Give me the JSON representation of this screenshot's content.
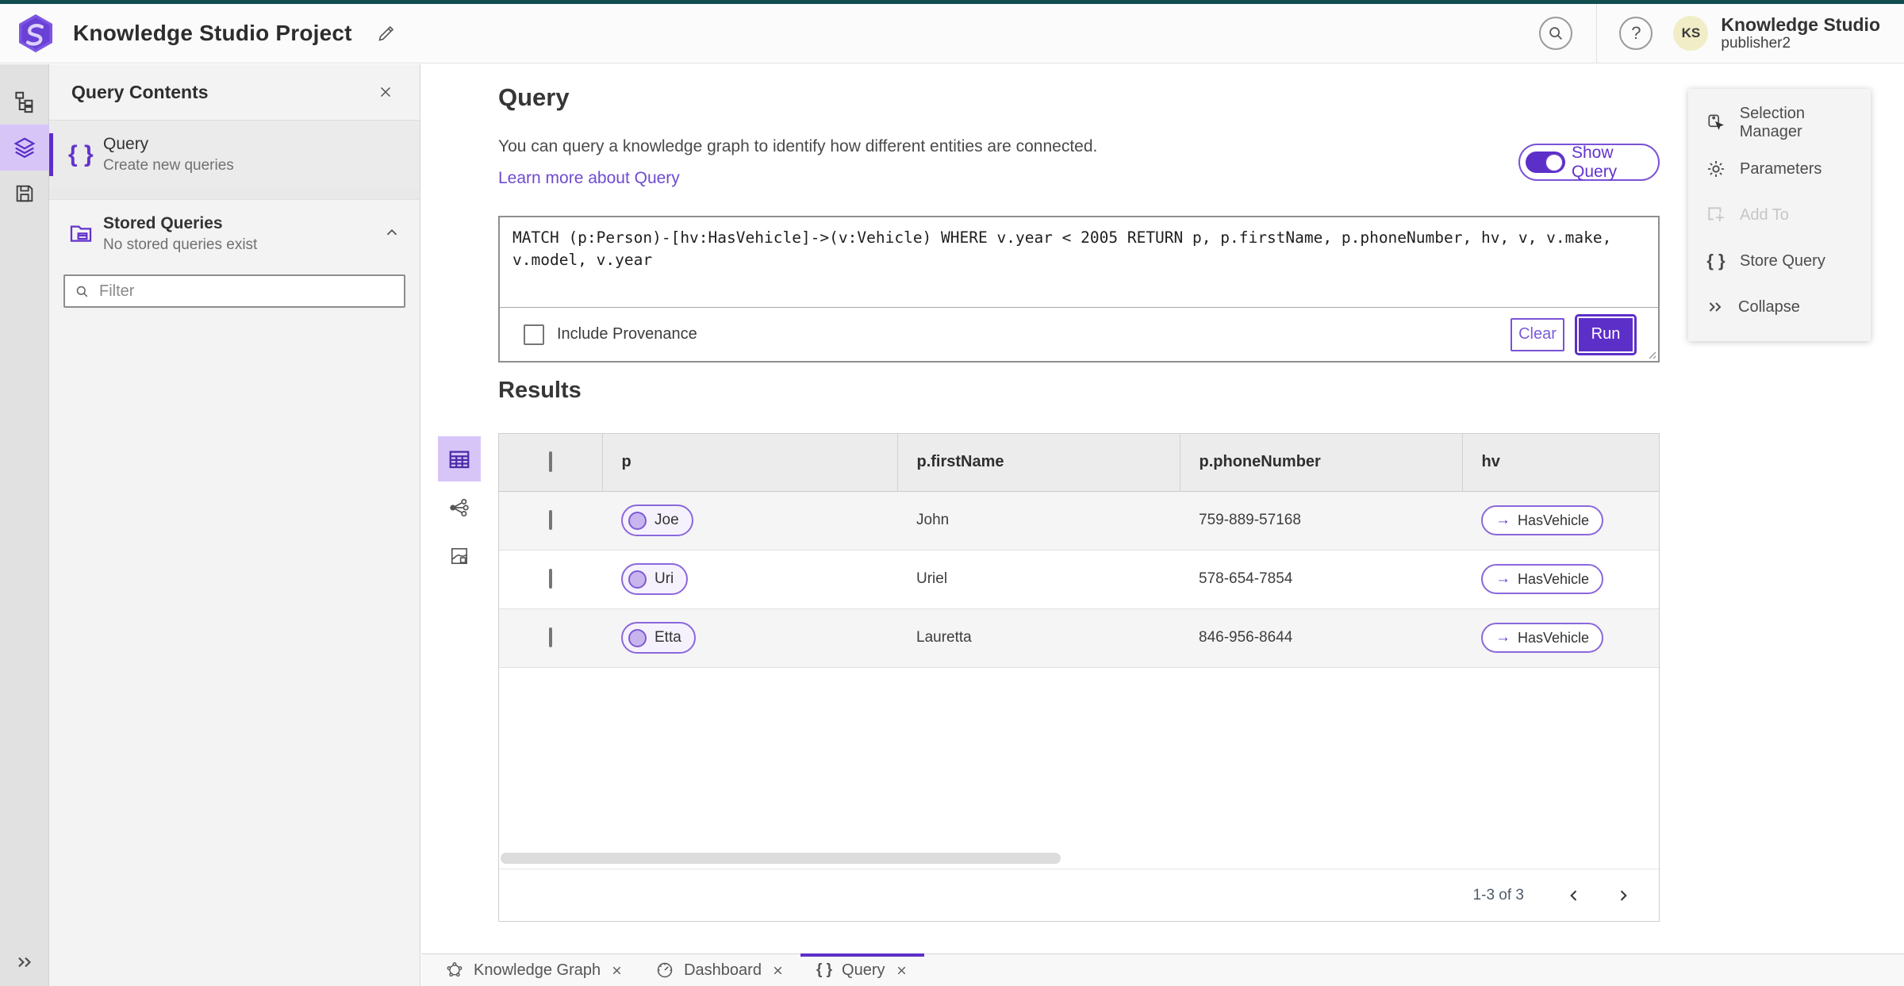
{
  "icons": {
    "braces": "{ }",
    "arrow_right": "→",
    "question": "?"
  },
  "colors": {
    "accent": "#5d2fc9",
    "accent_soft": "#d7c5f8",
    "link": "#6f4bd0",
    "chip_border": "#8a68dc",
    "top_strip": "#114d4f",
    "avatar_bg": "#f1edc7"
  },
  "header": {
    "title": "Knowledge Studio Project",
    "user_name": "Knowledge Studio",
    "user_role": "publisher2",
    "avatar_initials": "KS"
  },
  "sidebar_panel": {
    "title": "Query Contents",
    "query_item": {
      "title": "Query",
      "subtitle": "Create new queries"
    },
    "stored": {
      "title": "Stored Queries",
      "subtitle": "No stored queries exist"
    },
    "filter_placeholder": "Filter"
  },
  "query": {
    "heading": "Query",
    "description": "You can query a knowledge graph to identify how different entities are connected.",
    "learn_more": "Learn more about Query",
    "show_query": "Show Query",
    "code": "MATCH (p:Person)-[hv:HasVehicle]->(v:Vehicle) WHERE v.year < 2005 RETURN p, p.firstName, p.phoneNumber, hv, v, v.make, v.model, v.year",
    "include_provenance": "Include Provenance",
    "clear": "Clear",
    "run": "Run"
  },
  "results": {
    "heading": "Results",
    "columns": [
      "p",
      "p.firstName",
      "p.phoneNumber",
      "hv"
    ],
    "rows": [
      {
        "p": "Joe",
        "firstName": "John",
        "phone": "759-889-57168",
        "hv": "HasVehicle"
      },
      {
        "p": "Uri",
        "firstName": "Uriel",
        "phone": "578-654-7854",
        "hv": "HasVehicle"
      },
      {
        "p": "Etta",
        "firstName": "Lauretta",
        "phone": "846-956-8644",
        "hv": "HasVehicle"
      }
    ],
    "pagination": "1-3 of 3"
  },
  "actions": {
    "items": [
      {
        "label": "Selection Manager"
      },
      {
        "label": "Parameters"
      },
      {
        "label": "Add To"
      },
      {
        "label": "Store Query"
      },
      {
        "label": "Collapse"
      }
    ]
  },
  "tabs": [
    {
      "label": "Knowledge Graph"
    },
    {
      "label": "Dashboard"
    },
    {
      "label": "Query"
    }
  ]
}
